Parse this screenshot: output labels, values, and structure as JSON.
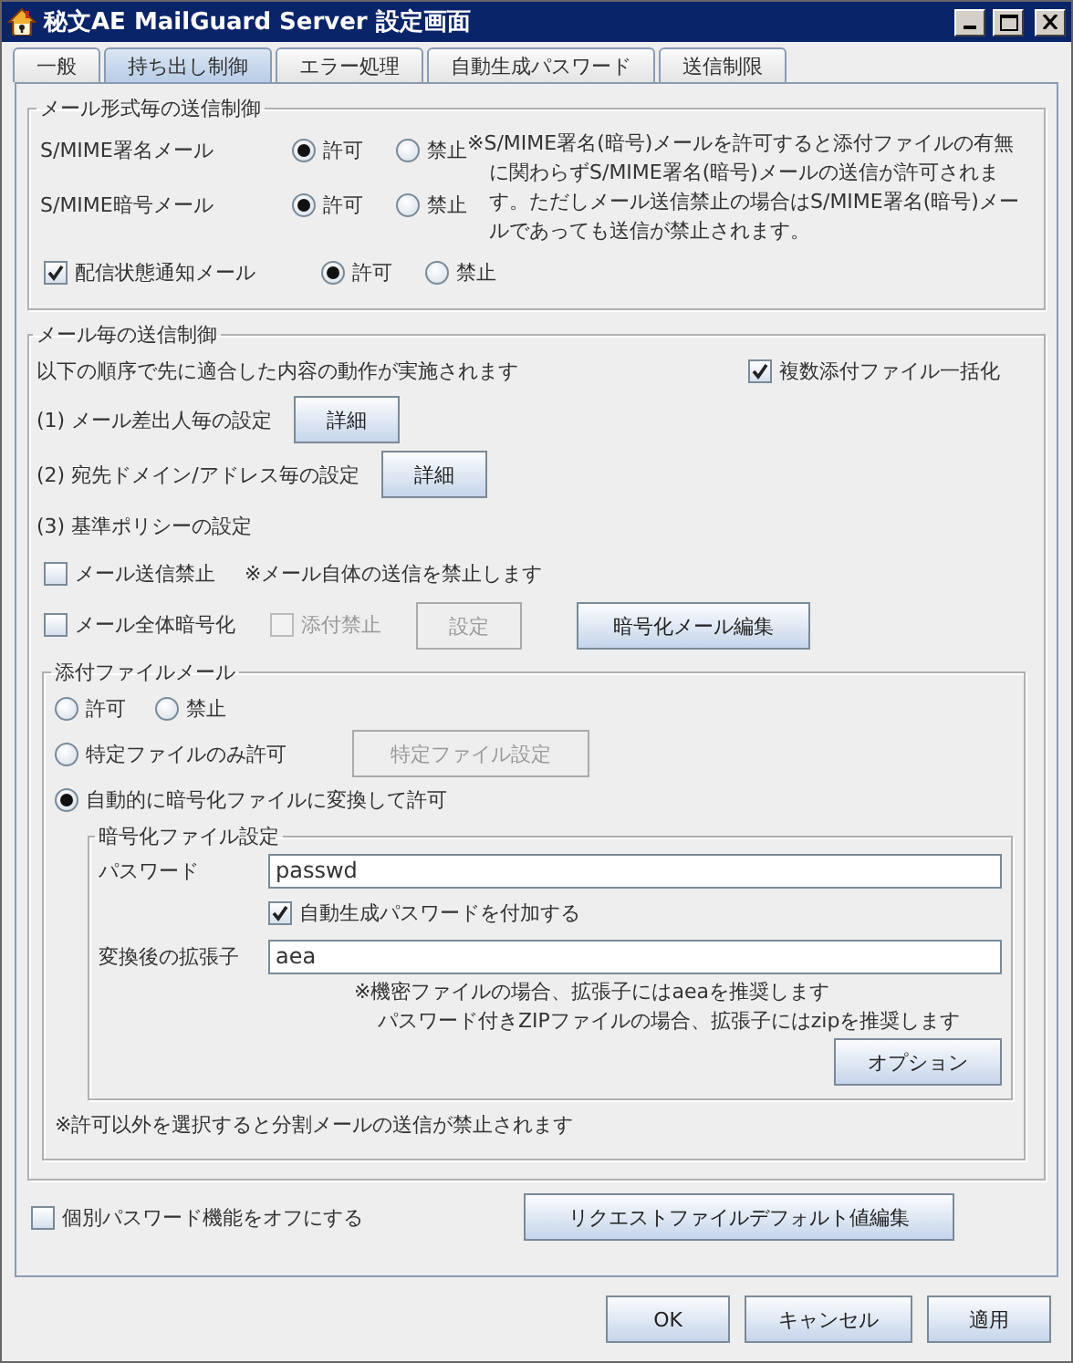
{
  "window": {
    "title": "秘文AE MailGuard Server 設定画面"
  },
  "tabs": [
    {
      "label": "一般",
      "selected": false
    },
    {
      "label": "持ち出し制御",
      "selected": true
    },
    {
      "label": "エラー処理",
      "selected": false
    },
    {
      "label": "自動生成パスワード",
      "selected": false
    },
    {
      "label": "送信制限",
      "selected": false
    }
  ],
  "format_group": {
    "title": "メール形式毎の送信制御",
    "rows": [
      {
        "kind": "plain",
        "label": "S/MIME署名メール",
        "options": [
          {
            "label": "許可",
            "selected": true
          },
          {
            "label": "禁止",
            "selected": false
          }
        ]
      },
      {
        "kind": "plain",
        "label": "S/MIME暗号メール",
        "options": [
          {
            "label": "許可",
            "selected": true
          },
          {
            "label": "禁止",
            "selected": false
          }
        ]
      },
      {
        "kind": "checkbox",
        "label": "配信状態通知メール",
        "checked": true,
        "options": [
          {
            "label": "許可",
            "selected": true
          },
          {
            "label": "禁止",
            "selected": false
          }
        ]
      }
    ],
    "note": "※S/MIME署名(暗号)メールを許可すると添付ファイルの有無に関わらずS/MIME署名(暗号)メールの送信が許可されます。ただしメール送信禁止の場合はS/MIME署名(暗号)メールであっても送信が禁止されます。"
  },
  "mail_group": {
    "title": "メール毎の送信制御",
    "intro": "以下の順序で先に適合した内容の動作が実施されます",
    "bundle": {
      "label": "複数添付ファイル一括化",
      "checked": true
    },
    "steps": [
      {
        "label": "(1) メール差出人毎の設定",
        "button": "詳細"
      },
      {
        "label": "(2) 宛先ドメイン/アドレス毎の設定",
        "button": "詳細"
      }
    ],
    "policy_label": "(3) 基準ポリシーの設定",
    "block_send": {
      "label": "メール送信禁止",
      "checked": false,
      "note": "※メール自体の送信を禁止します"
    },
    "encrypt_all": {
      "label": "メール全体暗号化",
      "checked": false
    },
    "attach_block": {
      "label": "添付禁止",
      "checked": false,
      "disabled": true
    },
    "settings_button": {
      "label": "設定",
      "disabled": true
    },
    "edit_button": "暗号化メール編集",
    "attachment_group": {
      "title": "添付ファイルメール",
      "options": [
        {
          "label": "許可",
          "selected": false
        },
        {
          "label": "禁止",
          "selected": false
        },
        {
          "label": "特定ファイルのみ許可",
          "selected": false
        },
        {
          "label": "自動的に暗号化ファイルに変換して許可",
          "selected": true
        }
      ],
      "specific_button": {
        "label": "特定ファイル設定",
        "disabled": true
      },
      "encryption": {
        "title": "暗号化ファイル設定",
        "password_label": "パスワード",
        "password": "passwd",
        "auto_password": {
          "label": "自動生成パスワードを付加する",
          "checked": true
        },
        "extension_label": "変換後の拡張子",
        "extension": "aea",
        "hints": [
          "※機密ファイルの場合、拡張子にはaeaを推奨します",
          "パスワード付きZIPファイルの場合、拡張子にはzipを推奨します"
        ],
        "option_button": "オプション"
      },
      "note": "※許可以外を選択すると分割メールの送信が禁止されます"
    }
  },
  "footer": {
    "password_off": {
      "label": "個別パスワード機能をオフにする",
      "checked": false
    },
    "request_button": "リクエストファイルデフォルト値編集"
  },
  "buttons": [
    "OK",
    "キャンセル",
    "適用"
  ]
}
